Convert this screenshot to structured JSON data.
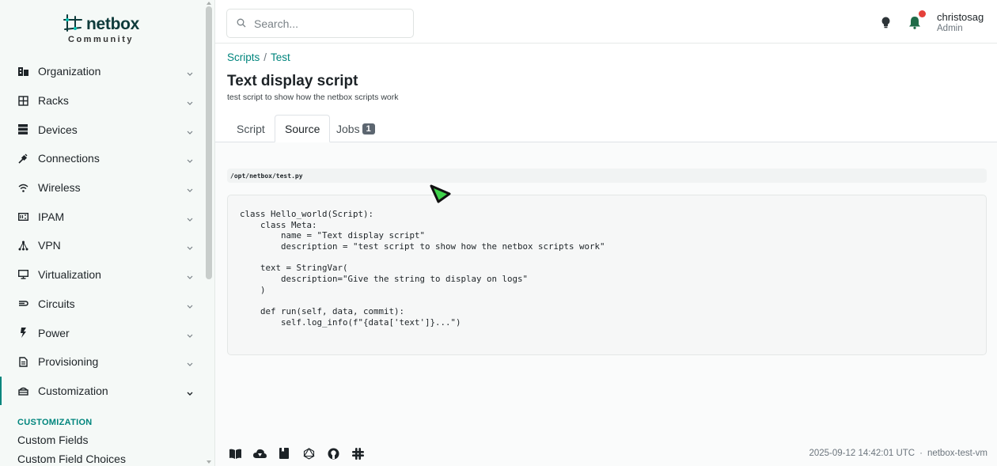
{
  "brand": {
    "name": "netbox",
    "subtitle": "Community"
  },
  "sidebar": {
    "items": [
      {
        "label": "Organization",
        "icon": "building-icon"
      },
      {
        "label": "Racks",
        "icon": "rack-icon"
      },
      {
        "label": "Devices",
        "icon": "server-icon"
      },
      {
        "label": "Connections",
        "icon": "plug-icon"
      },
      {
        "label": "Wireless",
        "icon": "wifi-icon"
      },
      {
        "label": "IPAM",
        "icon": "counter-icon"
      },
      {
        "label": "VPN",
        "icon": "network-icon"
      },
      {
        "label": "Virtualization",
        "icon": "monitor-icon"
      },
      {
        "label": "Circuits",
        "icon": "transit-icon"
      },
      {
        "label": "Power",
        "icon": "flash-icon"
      },
      {
        "label": "Provisioning",
        "icon": "file-document-icon"
      },
      {
        "label": "Customization",
        "icon": "palette-icon"
      }
    ],
    "submenu": {
      "header": "CUSTOMIZATION",
      "items": [
        "Custom Fields",
        "Custom Field Choices"
      ]
    }
  },
  "search": {
    "placeholder": "Search..."
  },
  "user": {
    "name": "christosag",
    "role": "Admin"
  },
  "breadcrumb": {
    "parent": "Scripts",
    "separator": "/",
    "current": "Test"
  },
  "page": {
    "title": "Text display script",
    "description": "test script to show how the netbox scripts work"
  },
  "tabs": [
    {
      "label": "Script"
    },
    {
      "label": "Source"
    },
    {
      "label": "Jobs",
      "badge": "1"
    }
  ],
  "file_path": "/opt/netbox/test.py",
  "code": "class Hello_world(Script):\n    class Meta:\n        name = \"Text display script\"\n        description = \"test script to show how the netbox scripts work\"\n\n    text = StringVar(\n        description=\"Give the string to display on logs\"\n    )\n\n    def run(self, data, commit):\n        self.log_info(f\"{data['text']}...\")",
  "footer": {
    "timestamp": "2025-09-12 14:42:01 UTC",
    "separator": "·",
    "hostname": "netbox-test-vm"
  },
  "colors": {
    "accent": "#00857d",
    "notification": "#e5403a"
  }
}
